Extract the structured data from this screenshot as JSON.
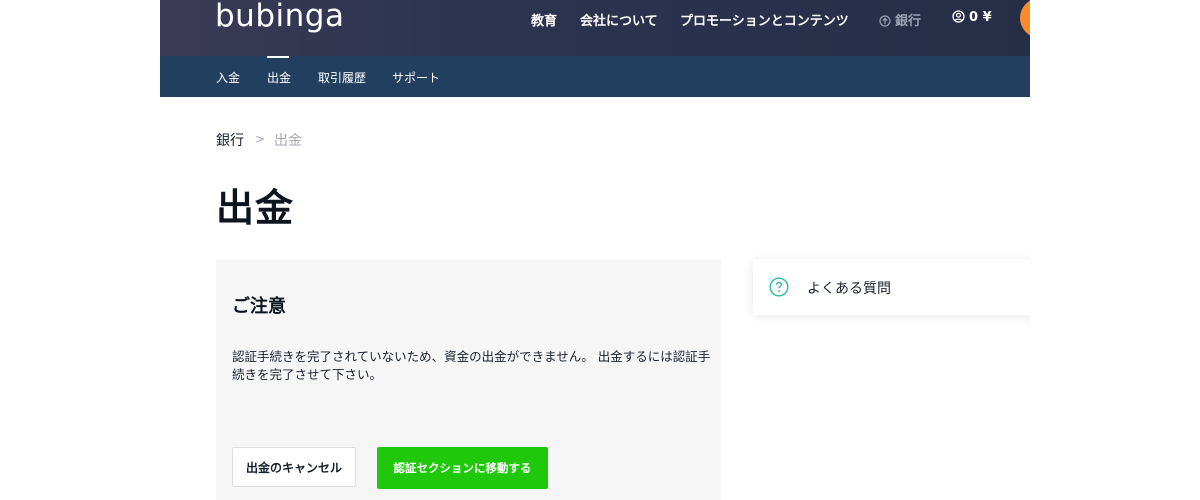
{
  "header": {
    "logo": "bubinga",
    "nav": [
      "教育",
      "会社について",
      "プロモーションとコンテンツ"
    ],
    "bank_label": "銀行",
    "balance": "0 ¥"
  },
  "subnav": {
    "items": [
      "入金",
      "出金",
      "取引履歴",
      "サポート"
    ],
    "active_index": 1
  },
  "breadcrumb": {
    "root": "銀行",
    "separator": ">",
    "current": "出金"
  },
  "page_title": "出金",
  "notice": {
    "title": "ご注意",
    "text": "認証手続きを完了されていないため、資金の出金ができません。 出金するには認証手続きを完了させて下さい。",
    "cancel_label": "出金のキャンセル",
    "verify_label": "認証セクションに移動する"
  },
  "faq": {
    "label": "よくある質問"
  },
  "colors": {
    "header_bg": "#2d3450",
    "subnav_bg": "#233f60",
    "accent_green": "#1fc80a",
    "accent_orange": "#ff8a2a",
    "faq_icon": "#2fb9a4"
  }
}
